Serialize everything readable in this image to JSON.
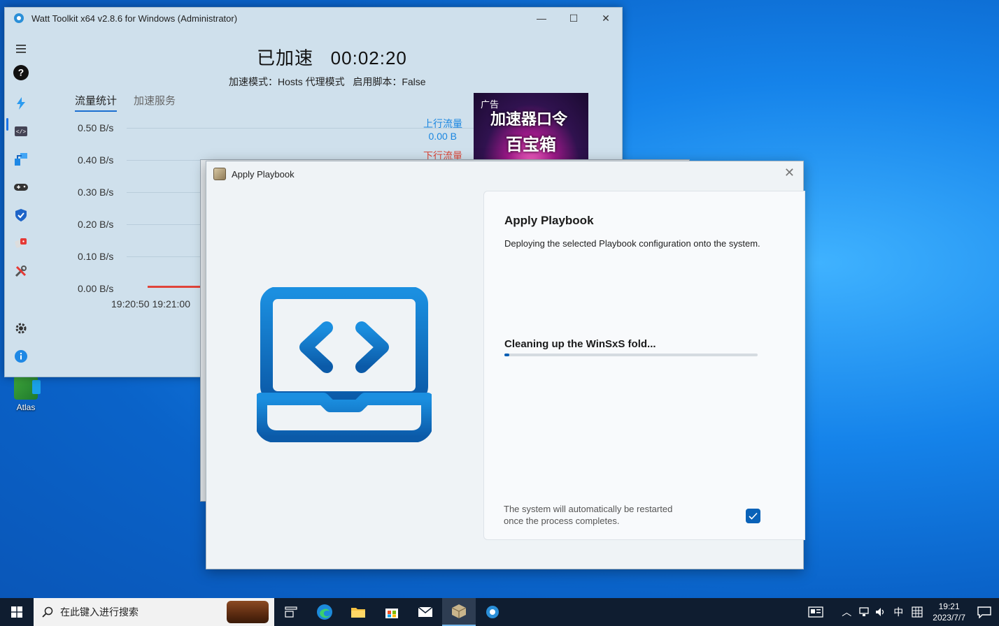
{
  "desktop": {
    "icon_label": "Atlas"
  },
  "watt": {
    "title": "Watt Toolkit x64 v2.8.6 for Windows (Administrator)",
    "status_title": "已加速   00:02:20",
    "status_sub": "加速模式：Hosts 代理模式   启用脚本：False",
    "tab_active": "流量统计",
    "tab_other": "加速服务",
    "y_labels": [
      "0.50 B/s",
      "0.40 B/s",
      "0.30 B/s",
      "0.20 B/s",
      "0.10 B/s",
      "0.00 B/s"
    ],
    "x_label_1": "19:20:50",
    "x_label_2": "19:21:00",
    "legend_up_label": "上行流量",
    "legend_up_value": "0.00 B",
    "legend_down_label": "下行流量",
    "ad_tag": "广告",
    "ad_line1": "加速器口令",
    "ad_line2": "百宝箱"
  },
  "dialog": {
    "title": "Apply Playbook",
    "heading": "Apply Playbook",
    "description": "Deploying the selected Playbook configuration onto the system.",
    "step": "Cleaning up the WinSxS fold...",
    "progress": 0.02,
    "note": "The system will automatically be restarted once the process completes.",
    "auto_restart_checked": true
  },
  "taskbar": {
    "search_placeholder": "在此键入进行搜索",
    "ime": "中",
    "time": "19:21",
    "date": "2023/7/7"
  },
  "colors": {
    "accent": "#0a5fb4",
    "upload": "#1a86e0",
    "download": "#d9473a"
  }
}
